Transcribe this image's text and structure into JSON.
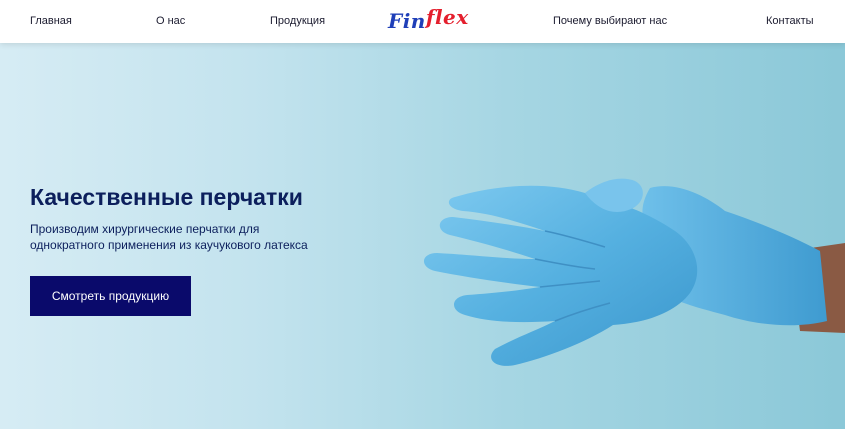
{
  "nav": {
    "items": [
      "Главная",
      "О нас",
      "Продукция",
      "Почему выбирают нас",
      "Контакты"
    ]
  },
  "logo": {
    "part1": "Fin",
    "part2": "flex"
  },
  "hero": {
    "title": "Качественные перчатки",
    "subtitle_line1": "Производим хирургические перчатки для",
    "subtitle_line2": "однократного применения из каучукового латекса",
    "cta_label": "Смотреть продукцию",
    "image": "gloved-hands-image"
  },
  "colors": {
    "brand_blue": "#1f3fb8",
    "brand_red": "#e41f2d",
    "title": "#0c1f5c",
    "button": "#0a0a6b",
    "glove": "#5ab4e0"
  }
}
